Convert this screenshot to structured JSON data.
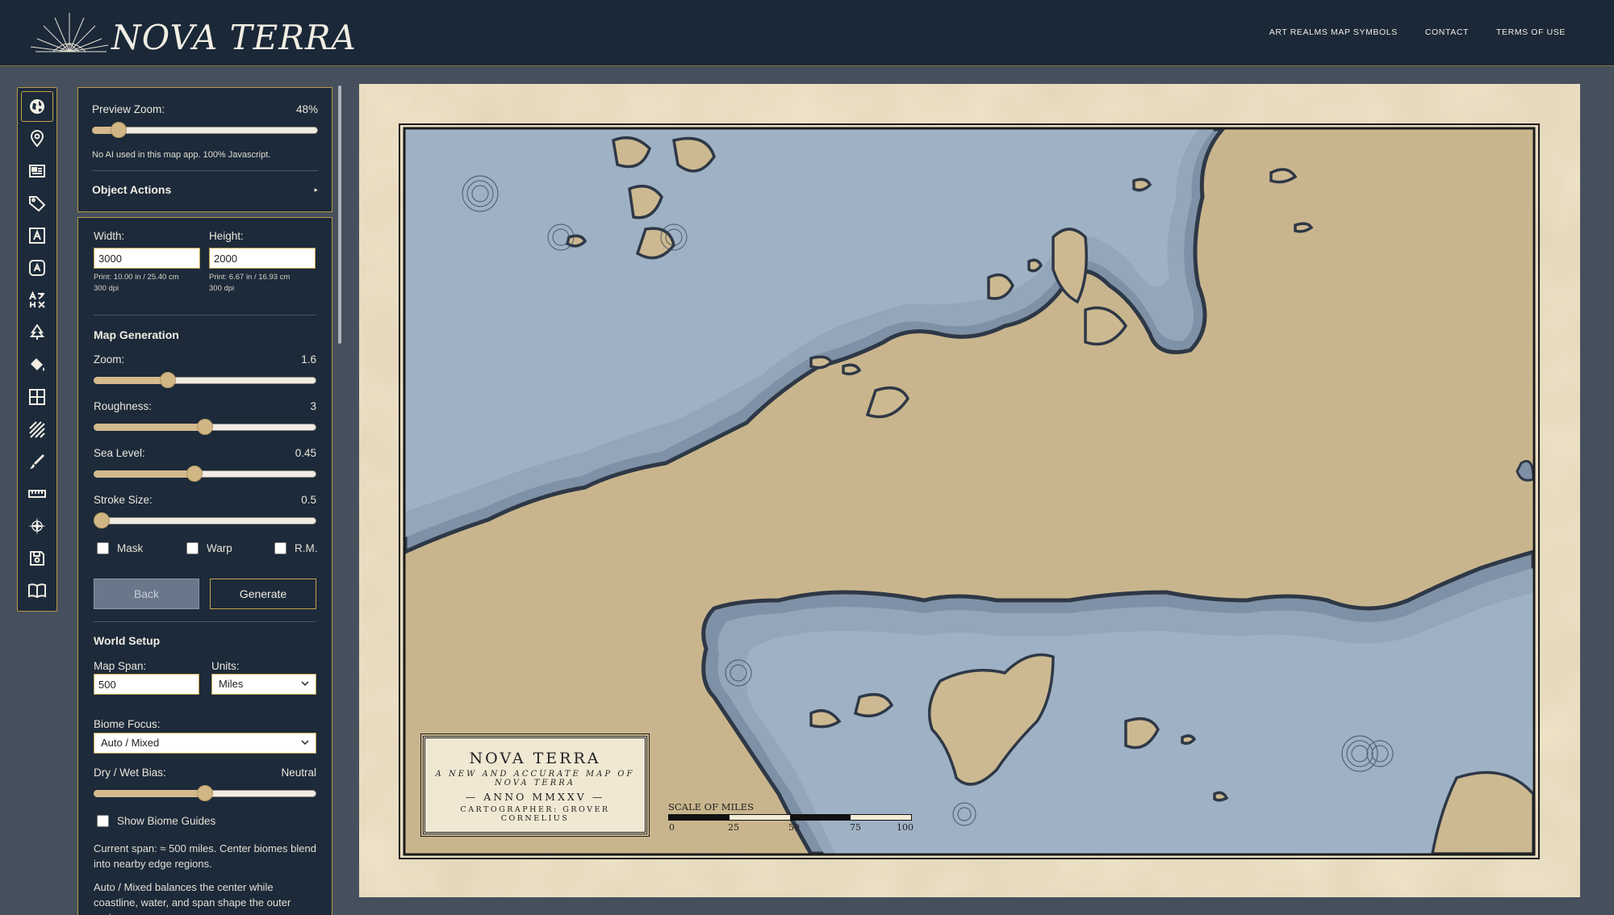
{
  "header": {
    "brand": "NOVA TERRA",
    "nav": [
      "ART REALMS MAP SYMBOLS",
      "CONTACT",
      "TERMS OF USE"
    ]
  },
  "tools": [
    {
      "icon": "globe-icon",
      "active": true
    },
    {
      "icon": "map-pin-icon"
    },
    {
      "icon": "panel-icon"
    },
    {
      "icon": "tag-icon"
    },
    {
      "icon": "text-box-icon"
    },
    {
      "icon": "text-badge-icon"
    },
    {
      "icon": "translate-icon"
    },
    {
      "icon": "tree-icon"
    },
    {
      "icon": "paint-bucket-icon"
    },
    {
      "icon": "grid-icon"
    },
    {
      "icon": "hatch-icon"
    },
    {
      "icon": "brush-icon"
    },
    {
      "icon": "ruler-icon"
    },
    {
      "icon": "compass-icon"
    },
    {
      "icon": "save-icon"
    },
    {
      "icon": "book-icon"
    }
  ],
  "preview": {
    "label": "Preview Zoom:",
    "value_text": "48%",
    "fraction": 0.09,
    "note": "No AI used in this map app. 100% Javascript.",
    "object_actions": "Object Actions",
    "arrow": "▸"
  },
  "size": {
    "width_label": "Width:",
    "width_value": "3000",
    "width_print": "Print: 10.00 in / 25.40 cm",
    "width_dpi": "300 dpi",
    "height_label": "Height:",
    "height_value": "2000",
    "height_print": "Print: 6.67 in / 16.93 cm",
    "height_dpi": "300 dpi"
  },
  "generation": {
    "heading": "Map Generation",
    "zoom_label": "Zoom:",
    "zoom_value": "1.6",
    "zoom_fraction": 0.32,
    "rough_label": "Roughness:",
    "rough_value": "3",
    "rough_fraction": 0.5,
    "sea_label": "Sea Level:",
    "sea_value": "0.45",
    "sea_fraction": 0.45,
    "stroke_label": "Stroke Size:",
    "stroke_value": "0.5",
    "stroke_fraction": 0.0,
    "mask": "Mask",
    "warp": "Warp",
    "rm": "R.M.",
    "back": "Back",
    "generate": "Generate"
  },
  "world": {
    "heading": "World Setup",
    "span_label": "Map Span:",
    "span_value": "500",
    "units_label": "Units:",
    "units_value": "Miles",
    "biome_label": "Biome Focus:",
    "biome_value": "Auto / Mixed",
    "bias_label": "Dry / Wet Bias:",
    "bias_value": "Neutral",
    "bias_fraction": 0.5,
    "guides": "Show Biome Guides",
    "span_text": "Current span: ≈ 500 miles. Center biomes blend into nearby edge regions.",
    "auto_text": "Auto / Mixed balances the center while coastline, water, and span shape the outer regions."
  },
  "map": {
    "title": "NOVA TERRA",
    "subtitle": "A NEW AND ACCURATE MAP OF NOVA TERRA",
    "anno": "— ANNO MMXXV —",
    "cartographer": "CARTOGRAPHER: GROVER CORNELIUS",
    "scale_title": "SCALE OF MILES",
    "scale_ticks": [
      "0",
      "25",
      "50",
      "75",
      "100"
    ],
    "land_color": "#cdb991",
    "water_color": "#9fb2c5",
    "coast_color": "#2e3846"
  }
}
